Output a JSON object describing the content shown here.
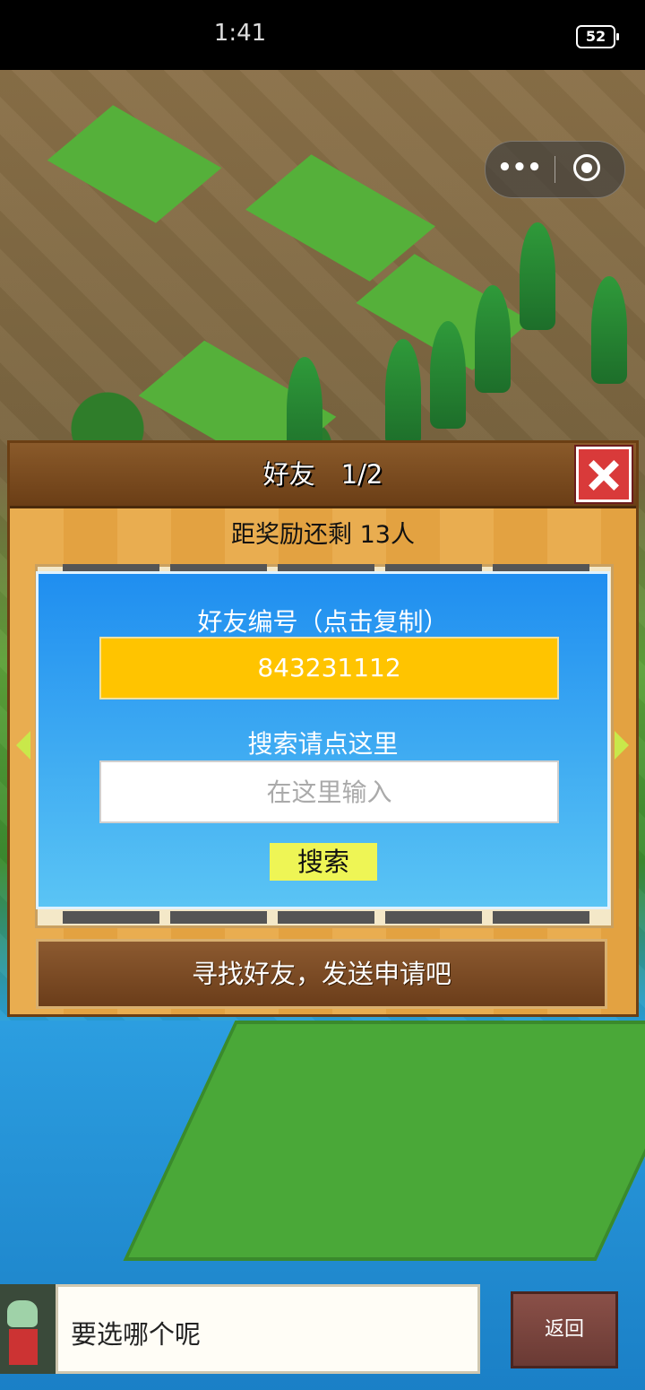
{
  "status_bar": {
    "time": "1:41",
    "battery": "52"
  },
  "capsule": {
    "more_icon": "•••",
    "close_icon": "target-close-icon"
  },
  "dialog": {
    "title": "好友　1/2",
    "reward_text": "距奖励还剩 13人",
    "friend_id_label": "好友编号（点击复制）",
    "friend_id": "843231112",
    "search_label": "搜索请点这里",
    "search_placeholder": "在这里输入",
    "search_button": "搜索",
    "find_button": "寻找好友，发送申请吧"
  },
  "bottom": {
    "speech": "要选哪个呢",
    "back_button": "返回"
  },
  "colors": {
    "friend_id_bg": "#ffc400",
    "panel_top": "#1f8ef0",
    "panel_bottom": "#5ac4f4",
    "search_button_bg": "#eef555",
    "close_button": "#d93a3a"
  }
}
